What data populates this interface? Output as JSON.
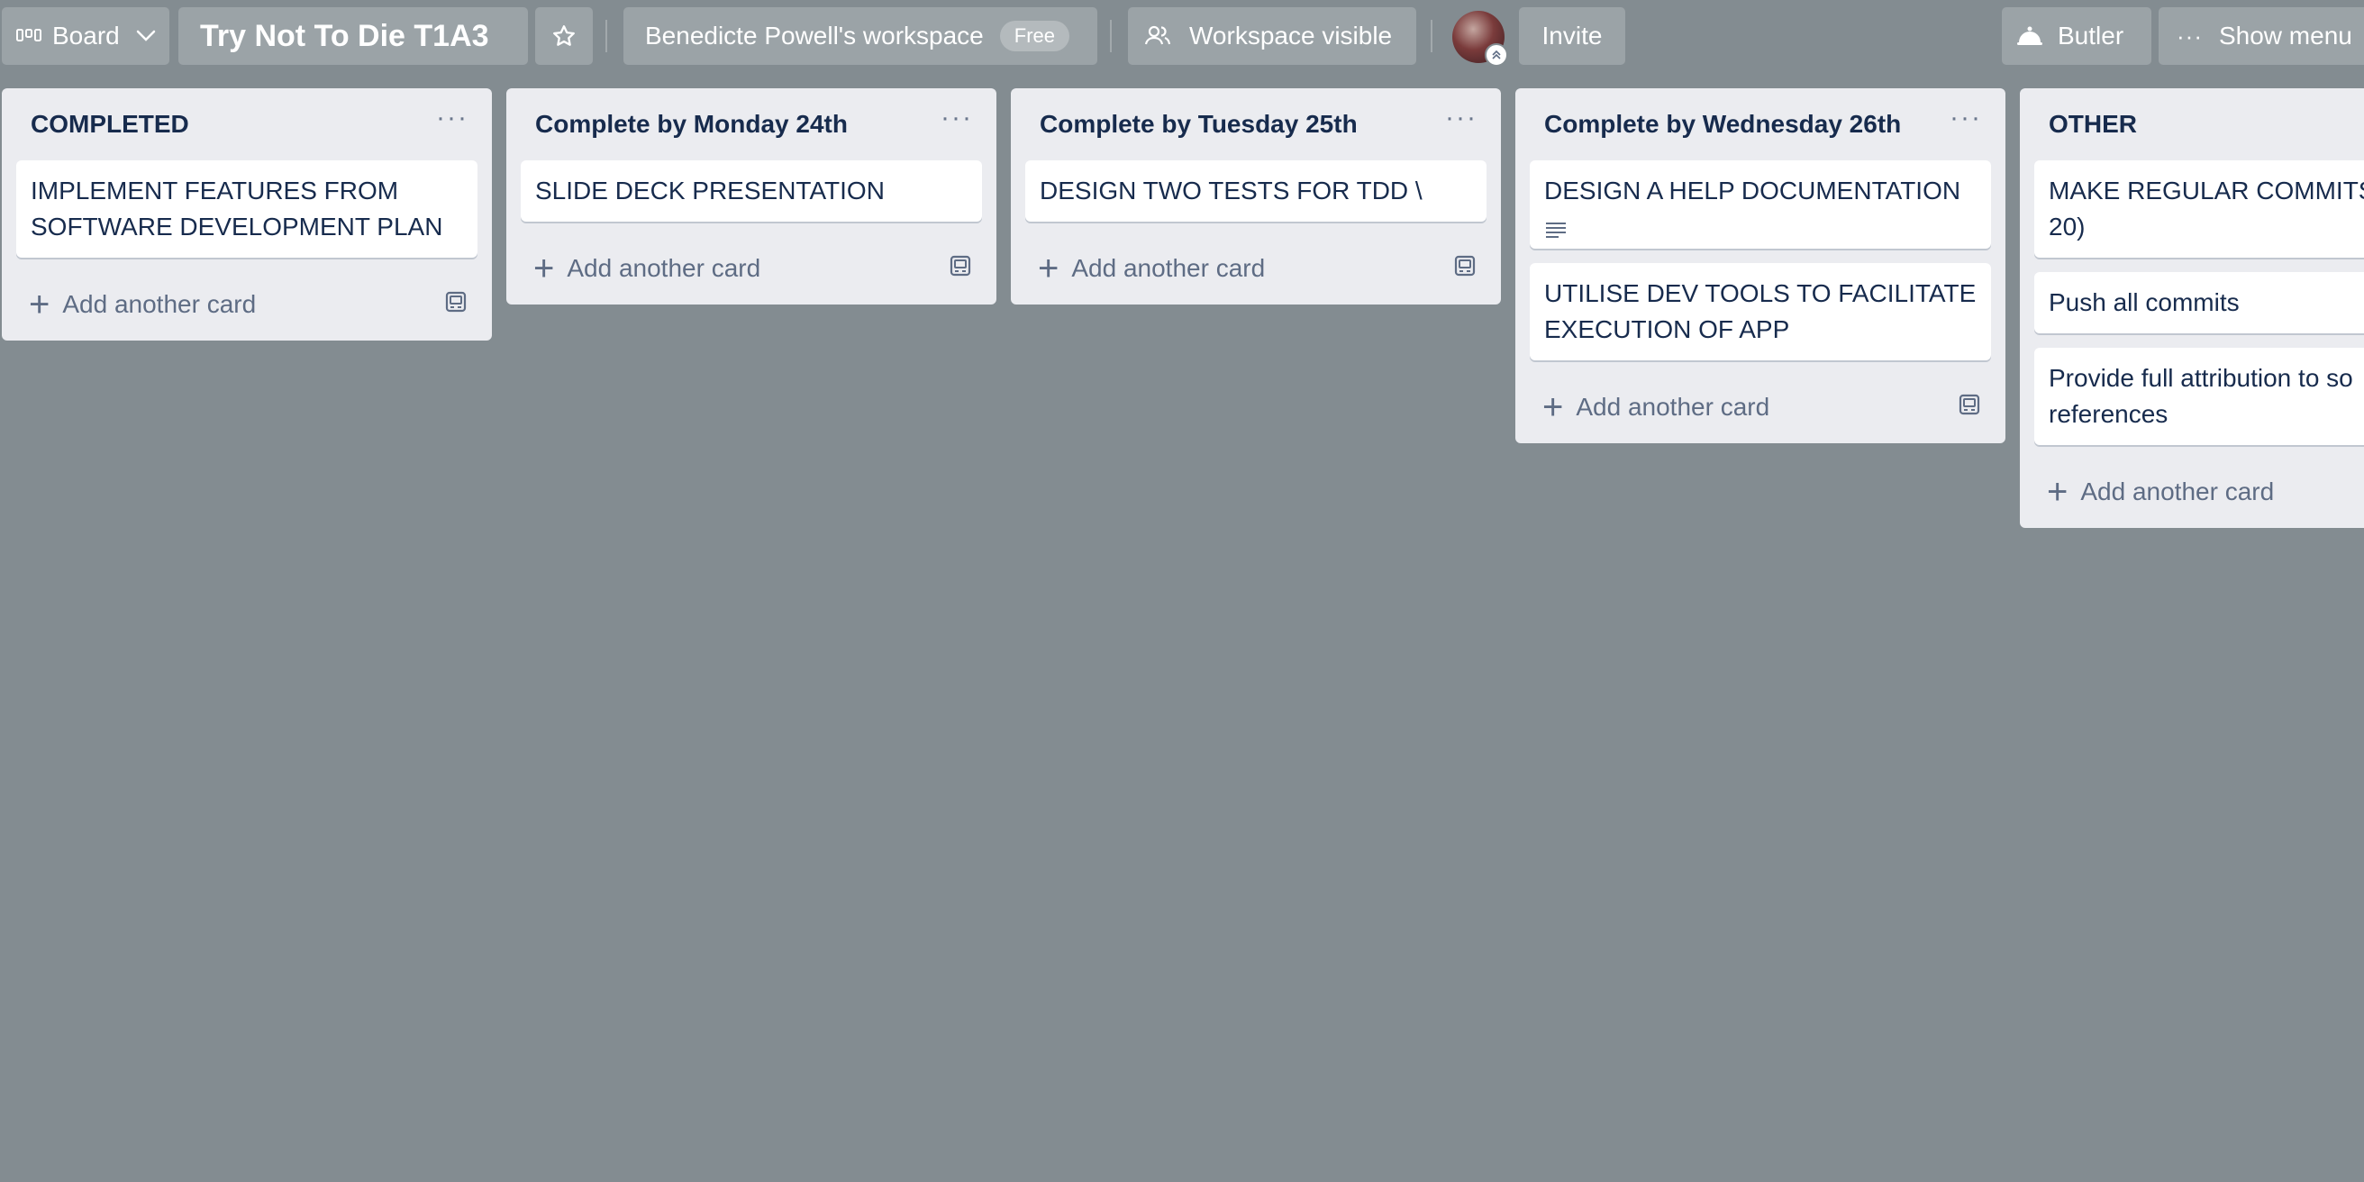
{
  "topbar": {
    "view_label": "Board",
    "board_title": "Try Not To Die T1A3",
    "workspace_name": "Benedicte Powell's workspace",
    "plan_badge": "Free",
    "visibility_label": "Workspace visible",
    "invite_label": "Invite",
    "butler_label": "Butler",
    "show_menu_label": "Show menu"
  },
  "lists": [
    {
      "title": "COMPLETED",
      "cards": [
        {
          "line1": "IMPLEMENT FEATURES FROM",
          "line2": "SOFTWARE DEVELOPMENT PLAN"
        }
      ],
      "add_label": "Add another card"
    },
    {
      "title": "Complete by Monday 24th",
      "cards": [
        {
          "line1": "SLIDE DECK PRESENTATION"
        }
      ],
      "add_label": "Add another card"
    },
    {
      "title": "Complete by Tuesday 25th",
      "cards": [
        {
          "line1": "DESIGN TWO TESTS FOR TDD \\"
        }
      ],
      "add_label": "Add another card"
    },
    {
      "title": "Complete by Wednesday 26th",
      "cards": [
        {
          "line1": "DESIGN A HELP DOCUMENTATION"
        },
        {
          "line1": "UTILISE DEV TOOLS TO FACILITATE",
          "line2": "EXECUTION OF APP"
        }
      ],
      "add_label": "Add another card"
    },
    {
      "title": "OTHER",
      "cards": [
        {
          "line1": "MAKE REGULAR COMMITS",
          "line2": "20)"
        },
        {
          "line1": "Push all commits"
        },
        {
          "line1": "Provide full attribution to so",
          "line2": "references"
        }
      ],
      "add_label": "Add another card"
    }
  ],
  "colors": {
    "board_background": "#838c91",
    "list_background": "#ebecf0",
    "card_background": "#ffffff",
    "text": "#172b4d"
  },
  "icons": [
    "board-icon",
    "chevron-down-icon",
    "star-icon",
    "people-icon",
    "butler-icon",
    "ellipsis-icon",
    "plus-icon",
    "template-icon",
    "description-icon"
  ]
}
